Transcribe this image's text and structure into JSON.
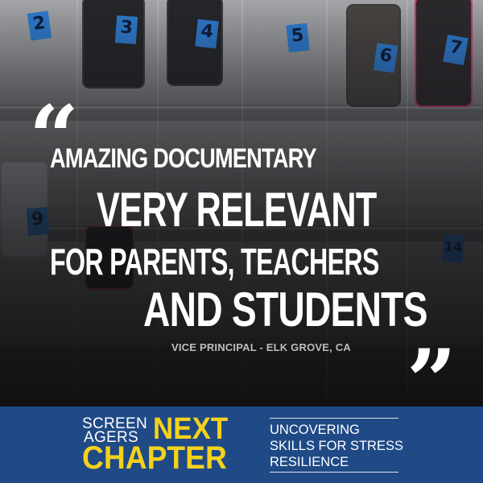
{
  "background": {
    "pocket_numbers": [
      "2",
      "3",
      "4",
      "5",
      "6",
      "7",
      "9",
      "14"
    ]
  },
  "quote": {
    "open_mark": "“",
    "close_mark": "”",
    "line1": "AMAZING DOCUMENTARY",
    "line2": "VERY RELEVANT",
    "line3": "FOR PARENTS, TEACHERS",
    "line4": "AND STUDENTS",
    "attribution": "VICE PRINCIPAL - ELK GROVE, CA"
  },
  "banner": {
    "logo": {
      "screen": "SCREEN",
      "agers": "AGERS",
      "next": "NEXT",
      "chapter": "CHAPTER"
    },
    "tagline": [
      "UNCOVERING",
      "SKILLS FOR STRESS",
      "RESILIENCE"
    ],
    "colors": {
      "background": "#1f4a86",
      "logo_accent": "#f4d21c",
      "text": "#ffffff"
    }
  }
}
